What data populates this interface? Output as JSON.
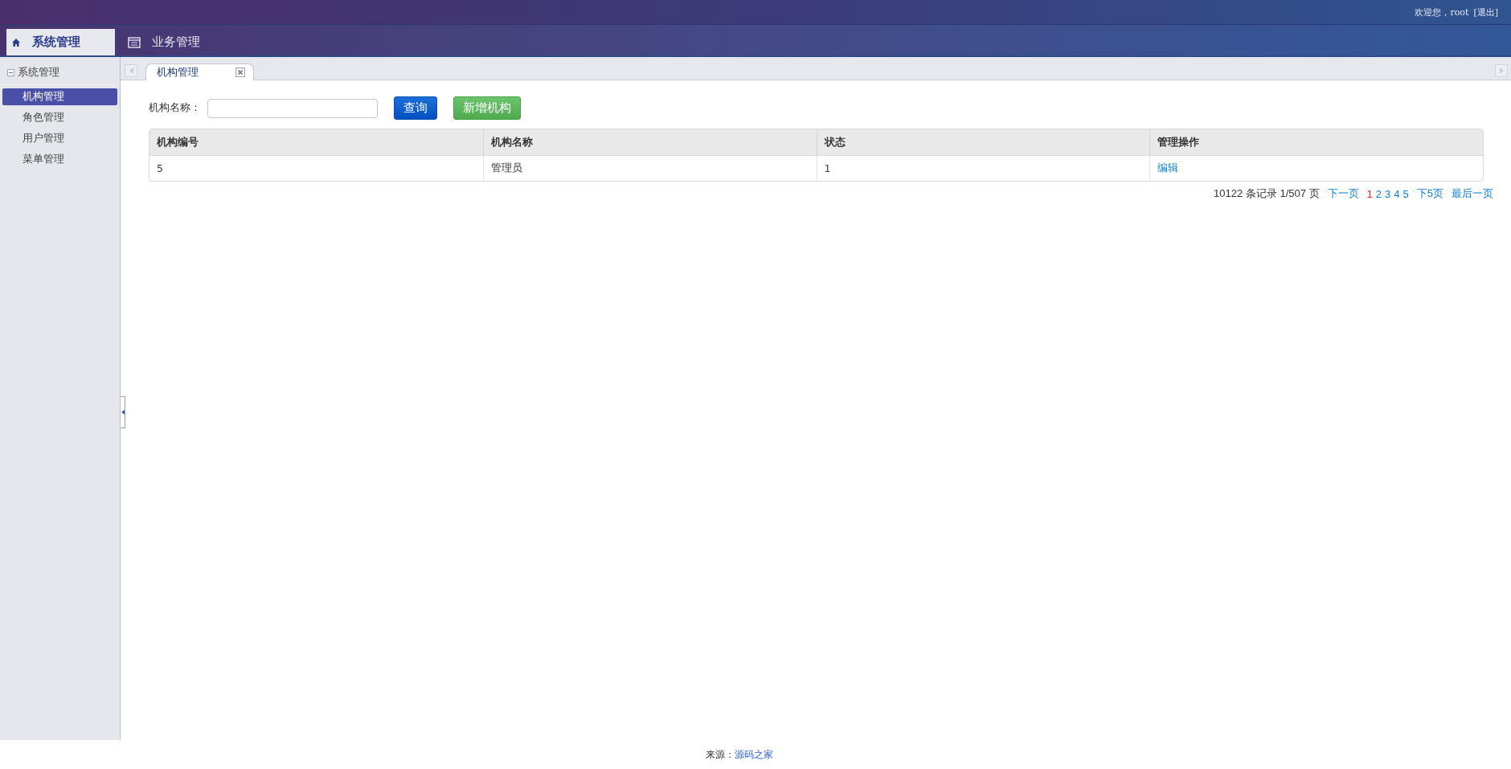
{
  "header": {
    "welcome": "欢迎您，root",
    "logout": "[退出]"
  },
  "top_tabs": [
    {
      "label": "系统管理",
      "kind": "home",
      "selected": true
    },
    {
      "label": "业务管理",
      "kind": "list",
      "selected": false
    }
  ],
  "sidebar": {
    "title": "系统管理",
    "expanded": true,
    "items": [
      {
        "label": "机构管理",
        "selected": true
      },
      {
        "label": "角色管理",
        "selected": false
      },
      {
        "label": "用户管理",
        "selected": false
      },
      {
        "label": "菜单管理",
        "selected": false
      }
    ]
  },
  "page_tabs": [
    {
      "label": "机构管理",
      "selected": true
    }
  ],
  "search": {
    "label": "机构名称：",
    "buttons": [
      {
        "label": "查询",
        "kind": "primary"
      },
      {
        "label": "新增机构",
        "kind": "success"
      }
    ]
  },
  "table": {
    "columns": [
      "机构编号",
      "机构名称",
      "状态",
      "管理操作"
    ],
    "rows": [
      {
        "cells": [
          "5",
          "管理员",
          "1"
        ],
        "action": "编辑"
      }
    ]
  },
  "pagination": {
    "summary": "10122 条记录 1/507 页",
    "next": "下一页",
    "pages": [
      {
        "label": "1",
        "selected": true
      },
      {
        "label": "2",
        "selected": false
      },
      {
        "label": "3",
        "selected": false
      },
      {
        "label": "4",
        "selected": false
      },
      {
        "label": "5",
        "selected": false
      }
    ],
    "next_group": "下5页",
    "last": "最后一页"
  },
  "footer": {
    "label": "来源：",
    "link": "源码之家"
  }
}
